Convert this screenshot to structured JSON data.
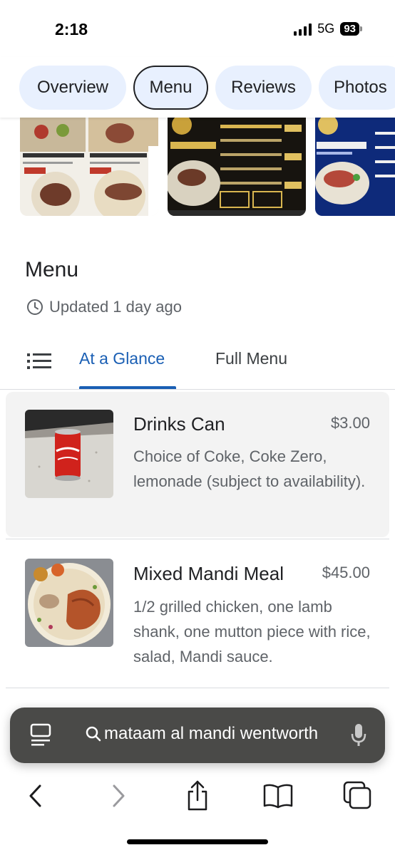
{
  "status_bar": {
    "time": "2:18",
    "network": "5G",
    "battery": "93"
  },
  "place_tabs": [
    {
      "label": "Overview",
      "active": false
    },
    {
      "label": "Menu",
      "active": true
    },
    {
      "label": "Reviews",
      "active": false
    },
    {
      "label": "Photos",
      "active": false
    }
  ],
  "menu": {
    "title": "Menu",
    "updated": "Updated 1 day ago",
    "tabs": [
      {
        "label": "At a Glance",
        "active": true
      },
      {
        "label": "Full Menu",
        "active": false
      }
    ],
    "items": [
      {
        "name": "Drinks Can",
        "price": "$3.00",
        "description": "Choice of Coke, Coke Zero, lemonade (subject to availability)."
      },
      {
        "name": "Mixed Mandi Meal",
        "price": "$45.00",
        "description": "1/2 grilled chicken, one lamb shank, one mutton piece with rice, salad, Mandi sauce."
      }
    ]
  },
  "search": {
    "query": "mataam al mandi wentworth"
  },
  "icons": {
    "clock": "clock-icon",
    "list": "list-icon",
    "reader": "reader-icon",
    "search": "search-icon",
    "mic": "mic-icon",
    "back": "back-icon",
    "forward": "forward-icon",
    "share": "share-icon",
    "bookmarks": "bookmarks-icon",
    "tabs": "tabs-icon"
  },
  "colors": {
    "accent": "#1a5fb4",
    "chip_bg": "#e8f0fe",
    "search_bar_bg": "#4a4a48"
  }
}
